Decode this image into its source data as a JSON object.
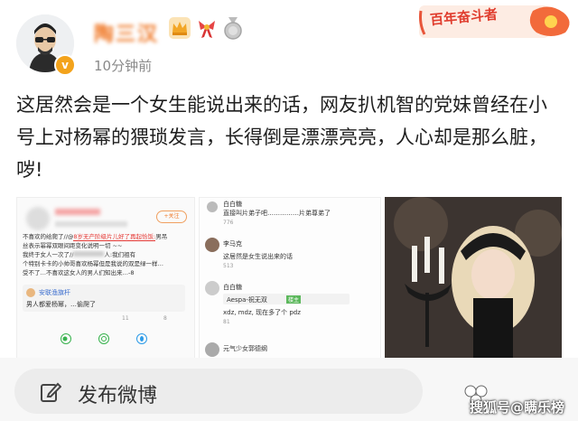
{
  "header": {
    "username": "陶三汉",
    "timestamp": "10分钟前",
    "banner_text": "百年奋斗者"
  },
  "post": {
    "text": "这居然会是一个女生能说出来的话，网友扒机智的党妹曾经在小号上对杨幂的猥琐发言，长得倒是漂漂亮亮，人心却是那么脏，哕!"
  },
  "image1": {
    "follow": "+关注",
    "highlight": "8岁无产阶级片儿好了再起恰饭:",
    "line1": "不喜欢的给爬了//@",
    "line1b": "男吊",
    "line2": "丝表示幂幂双眼间距变化说明一切 ~~",
    "line3": "我终于女人一次了//",
    "line3b": "人:我们祖有",
    "line4": "个特别卡卡的小帅哥喜欢杨幂但是我说的双是绿一样…",
    "line5": "受不了…不喜欢这女人的男人们知出来…-",
    "line5b": "8",
    "commenter": "安联渔旗杆",
    "comment": "男人都爱杨幂，…偷爬了",
    "stat1": "11",
    "stat2": "8"
  },
  "image2": {
    "user1": "白白糖",
    "text1": "直接叫片弟子吧……………片弟尊弟了",
    "likes1": "776",
    "user2": "李马克",
    "text2": "这居然是女生说出来的话",
    "likes2": "513",
    "user3": "白白糖",
    "reply_user": "Aespa-祝无双",
    "reply_tag": "楼主",
    "reply_text": "xdz, mdz, 现在多了个 pdz",
    "likes3": "81",
    "user4": "元气少女郭德纲"
  },
  "compose": {
    "label": "发布微博"
  },
  "watermark": {
    "text": "搜狐号@瞒乐榜"
  },
  "colors": {
    "username": "#f07b2b",
    "badge": "#f3a31c",
    "highlight": "#e53935",
    "link": "#3b6ecf"
  }
}
